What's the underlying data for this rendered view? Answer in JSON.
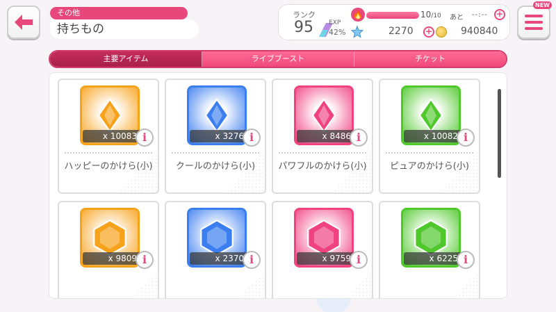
{
  "header": {
    "category": "その他",
    "title": "持ちもの"
  },
  "status": {
    "rank_label": "ランク",
    "rank": "95",
    "exp_label": "EXP",
    "exp_percent": "42%",
    "stamina_current": "10",
    "stamina_max": "/10",
    "stamina_remaining_label": "あと",
    "stamina_time": "--:--",
    "stamina_fraction": 1.0,
    "stars": "2270",
    "coins": "940840"
  },
  "menu": {
    "badge": "NEW"
  },
  "tabs": [
    {
      "label": "主要アイテム",
      "active": true
    },
    {
      "label": "ライブブースト",
      "active": false
    },
    {
      "label": "チケット",
      "active": false
    }
  ],
  "items": [
    {
      "count": "x 10083",
      "name": "ハッピーのかけら(小)",
      "color": "#f7a21b",
      "icon": "small-diamond-shard"
    },
    {
      "count": "x 3276",
      "name": "クールのかけら(小)",
      "color": "#3b7ef0",
      "icon": "small-diamond-shard"
    },
    {
      "count": "x 8486",
      "name": "パワフルのかけら(小)",
      "color": "#f0427f",
      "icon": "small-diamond-shard"
    },
    {
      "count": "x 10082",
      "name": "ピュアのかけら(小)",
      "color": "#4fc82c",
      "icon": "small-diamond-shard"
    },
    {
      "count": "x 9809",
      "name": "",
      "color": "#f7a21b",
      "icon": "hexagon-shard"
    },
    {
      "count": "x 2370",
      "name": "",
      "color": "#3b7ef0",
      "icon": "hexagon-shard"
    },
    {
      "count": "x 9759",
      "name": "",
      "color": "#f0427f",
      "icon": "hexagon-shard"
    },
    {
      "count": "x 6225",
      "name": "",
      "color": "#4fc82c",
      "icon": "hexagon-shard"
    }
  ],
  "info_label": "i"
}
